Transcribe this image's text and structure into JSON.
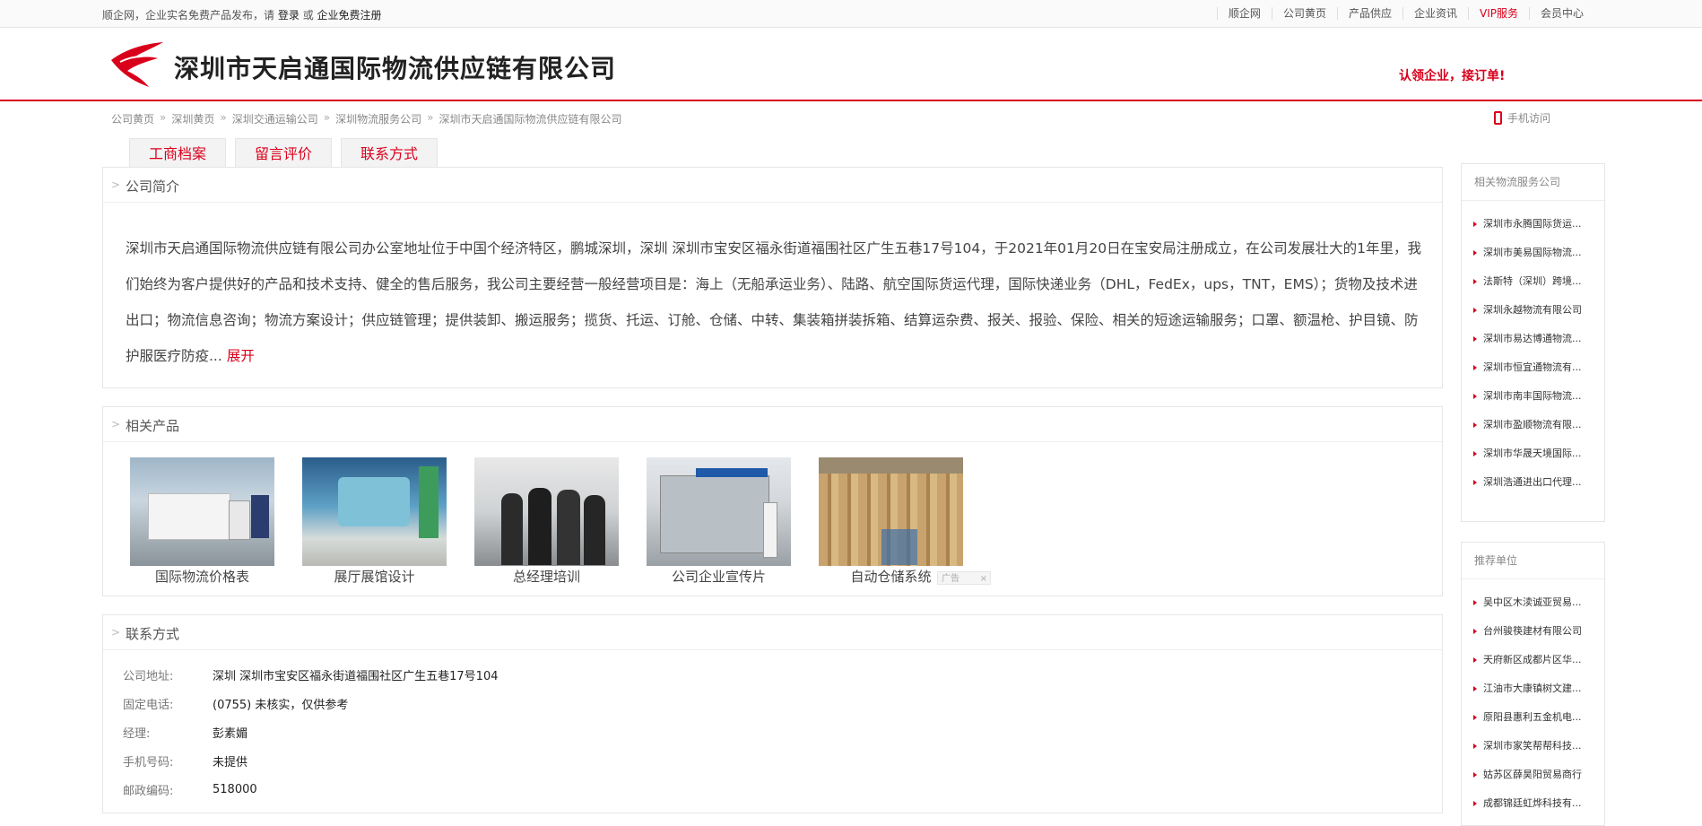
{
  "topbar": {
    "left_text": "顺企网，企业实名免费产品发布，请",
    "login": "登录",
    "or": "或",
    "register": "企业免费注册",
    "nav": [
      "顺企网",
      "公司黄页",
      "产品供应",
      "企业资讯",
      "VIP服务",
      "会员中心"
    ]
  },
  "header": {
    "company_name": "深圳市天启通国际物流供应链有限公司",
    "claim": "认领企业，接订单!"
  },
  "breadcrumb": [
    "公司黄页",
    "深圳黄页",
    "深圳交通运输公司",
    "深圳物流服务公司",
    "深圳市天启通国际物流供应链有限公司"
  ],
  "breadcrumb_sep": "»",
  "mobile_visit": "手机访问",
  "tabs": [
    "工商档案",
    "留言评价",
    "联系方式"
  ],
  "intro": {
    "title": "公司简介",
    "text": "深圳市天启通国际物流供应链有限公司办公室地址位于中国个经济特区，鹏城深圳，深圳 深圳市宝安区福永街道福围社区广生五巷17号104，于2021年01月20日在宝安局注册成立，在公司发展壮大的1年里，我们始终为客户提供好的产品和技术支持、健全的售后服务，我公司主要经营一般经营项目是：海上（无船承运业务）、陆路、航空国际货运代理，国际快递业务（DHL，FedEx，ups，TNT，EMS）；货物及技术进出口；物流信息咨询；物流方案设计；供应链管理；提供装卸、搬运服务；揽货、托运、订舱、仓储、中转、集装箱拼装拆箱、结算运杂费、报关、报验、保险、相关的短途运输服务；口罩、额温枪、护目镜、防护服医疗防疫...",
    "expand": "展开"
  },
  "products": {
    "title": "相关产品",
    "items": [
      "国际物流价格表",
      "展厅展馆设计",
      "总经理培训",
      "公司企业宣传片",
      "自动仓储系统"
    ],
    "ad_label": "广告"
  },
  "contact": {
    "title": "联系方式",
    "rows": [
      {
        "k": "公司地址:",
        "v": "深圳 深圳市宝安区福永街道福围社区广生五巷17号104"
      },
      {
        "k": "固定电话:",
        "v": "(0755) 未核实，仅供参考"
      },
      {
        "k": "经理:",
        "v": "彭素媚"
      },
      {
        "k": "手机号码:",
        "v": "未提供"
      },
      {
        "k": "邮政编码:",
        "v": "518000"
      }
    ]
  },
  "sidebar_related": {
    "title": "相关物流服务公司",
    "items": [
      "深圳市永腾国际货运...",
      "深圳市美易国际物流...",
      "法斯特（深圳）跨境...",
      "深圳永越物流有限公司",
      "深圳市易达博通物流...",
      "深圳市恒宜通物流有...",
      "深圳市南丰国际物流...",
      "深圳市盈顺物流有限...",
      "深圳市华晟天境国际...",
      "深圳浩通进出口代理..."
    ]
  },
  "sidebar_recommend": {
    "title": "推荐单位",
    "items": [
      "吴中区木渎诚亚贸易...",
      "台州骏筷建材有限公司",
      "天府新区成都片区华...",
      "江油市大康镇树文建...",
      "原阳县惠利五金机电...",
      "深圳市家笑帮帮科技...",
      "姑苏区薛昊阳贸易商行",
      "成都锦廷虹烨科技有..."
    ]
  },
  "colors": {
    "accent": "#d9001b"
  }
}
